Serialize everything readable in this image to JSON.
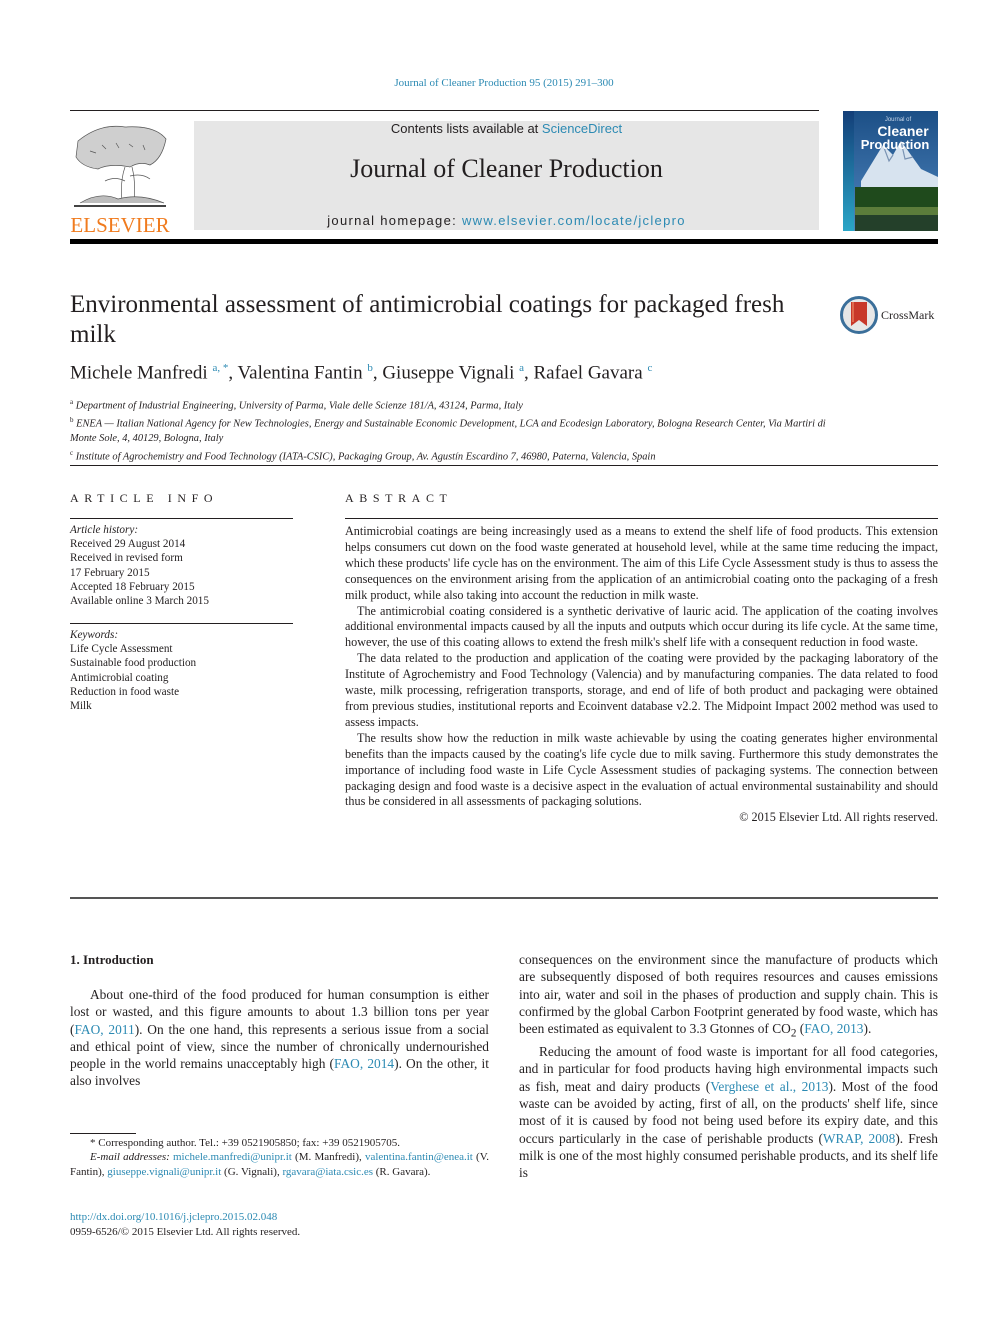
{
  "header": {
    "citation": "Journal of Cleaner Production 95 (2015) 291–300",
    "publisher_logo_text": "ELSEVIER",
    "contents_prefix": "Contents lists available at ",
    "contents_link": "ScienceDirect",
    "journal_name": "Journal of Cleaner Production",
    "homepage_prefix": "journal homepage: ",
    "homepage_link": "www.elsevier.com/locate/jclepro",
    "cover_title_small": "Journal of",
    "cover_title_line1": "Cleaner",
    "cover_title_line2": "Production"
  },
  "article": {
    "title": "Environmental assessment of antimicrobial coatings for packaged fresh milk",
    "crossmark_label": "CrossMark",
    "authors": [
      {
        "name": "Michele Manfredi",
        "sup": "a, *"
      },
      {
        "name": "Valentina Fantin",
        "sup": "b"
      },
      {
        "name": "Giuseppe Vignali",
        "sup": "a"
      },
      {
        "name": "Rafael Gavara",
        "sup": "c"
      }
    ],
    "affiliations": [
      {
        "key": "a",
        "text": "Department of Industrial Engineering, University of Parma, Viale delle Scienze 181/A, 43124, Parma, Italy"
      },
      {
        "key": "b",
        "text": "ENEA — Italian National Agency for New Technologies, Energy and Sustainable Economic Development, LCA and Ecodesign Laboratory, Bologna Research Center, Via Martiri di Monte Sole, 4, 40129, Bologna, Italy"
      },
      {
        "key": "c",
        "text": "Institute of Agrochemistry and Food Technology (IATA-CSIC), Packaging Group, Av. Agustín Escardino 7, 46980, Paterna, Valencia, Spain"
      }
    ]
  },
  "article_info": {
    "heading": "ARTICLE INFO",
    "history_label": "Article history:",
    "history": [
      "Received 29 August 2014",
      "Received in revised form",
      "17 February 2015",
      "Accepted 18 February 2015",
      "Available online 3 March 2015"
    ],
    "keywords_label": "Keywords:",
    "keywords": [
      "Life Cycle Assessment",
      "Sustainable food production",
      "Antimicrobial coating",
      "Reduction in food waste",
      "Milk"
    ]
  },
  "abstract": {
    "heading": "ABSTRACT",
    "paragraphs": [
      "Antimicrobial coatings are being increasingly used as a means to extend the shelf life of food products. This extension helps consumers cut down on the food waste generated at household level, while at the same time reducing the impact, which these products' life cycle has on the environment. The aim of this Life Cycle Assessment study is thus to assess the consequences on the environment arising from the application of an antimicrobial coating onto the packaging of a fresh milk product, while also taking into account the reduction in milk waste.",
      "The antimicrobial coating considered is a synthetic derivative of lauric acid. The application of the coating involves additional environmental impacts caused by all the inputs and outputs which occur during its life cycle. At the same time, however, the use of this coating allows to extend the fresh milk's shelf life with a consequent reduction in food waste.",
      "The data related to the production and application of the coating were provided by the packaging laboratory of the Institute of Agrochemistry and Food Technology (Valencia) and by manufacturing companies. The data related to food waste, milk processing, refrigeration transports, storage, and end of life of both product and packaging were obtained from previous studies, institutional reports and Ecoinvent database v2.2. The Midpoint Impact 2002 method was used to assess impacts.",
      "The results show how the reduction in milk waste achievable by using the coating generates higher environmental benefits than the impacts caused by the coating's life cycle due to milk saving. Furthermore this study demonstrates the importance of including food waste in Life Cycle Assessment studies of packaging systems. The connection between packaging design and food waste is a decisive aspect in the evaluation of actual environmental sustainability and should thus be considered in all assessments of packaging solutions."
    ],
    "copyright": "© 2015 Elsevier Ltd. All rights reserved."
  },
  "body": {
    "section_heading": "1.  Introduction",
    "left_p1": {
      "t1": "About one-third of the food produced for human consumption is either lost or wasted, and this figure amounts to about 1.3 billion tons per year (",
      "ref1": "FAO, 2011",
      "t2": "). On the one hand, this represents a serious issue from a social and ethical point of view, since the number of chronically undernourished people in the world remains unacceptably high (",
      "ref2": "FAO, 2014",
      "t3": "). On the other, it also involves"
    },
    "right_p1": {
      "t1": "consequences on the environment since the manufacture of products which are subsequently disposed of both requires resources and causes emissions into air, water and soil in the phases of production and supply chain. This is confirmed by the global Carbon Footprint generated by food waste, which has been estimated as equivalent to 3.3 Gtonnes of CO",
      "sub": "2",
      "t2": " (",
      "ref1": "FAO, 2013",
      "t3": ")."
    },
    "right_p2": {
      "t1": "Reducing the amount of food waste is important for all food categories, and in particular for food products having high environmental impacts such as fish, meat and dairy products (",
      "ref1": "Verghese et al., 2013",
      "t2": "). Most of the food waste can be avoided by acting, first of all, on the products' shelf life, since most of it is caused by food not being used before its expiry date, and this occurs particularly in the case of perishable products (",
      "ref2": "WRAP, 2008",
      "t3": "). Fresh milk is one of the most highly consumed perishable products, and its shelf life is"
    }
  },
  "footnotes": {
    "corresponding": "* Corresponding author. Tel.: +39 0521905850; fax: +39 0521905705.",
    "email_label": "E-mail addresses:",
    "emails": [
      {
        "email": "michele.manfredi@unipr.it",
        "who": " (M. Manfredi), "
      },
      {
        "email": "valentina.fantin@enea.it",
        "who": " (V. Fantin), "
      },
      {
        "email": "giuseppe.vignali@unipr.it",
        "who": " (G. Vignali), "
      },
      {
        "email": "rgavara@iata.csic.es",
        "who": " (R. Gavara)."
      }
    ],
    "doi": "http://dx.doi.org/10.1016/j.jclepro.2015.02.048",
    "issn": "0959-6526/© 2015 Elsevier Ltd. All rights reserved."
  },
  "colors": {
    "link": "#2c8ab3",
    "elsevier_orange": "#f07b1e",
    "masthead_gray": "#e6e6e6"
  }
}
